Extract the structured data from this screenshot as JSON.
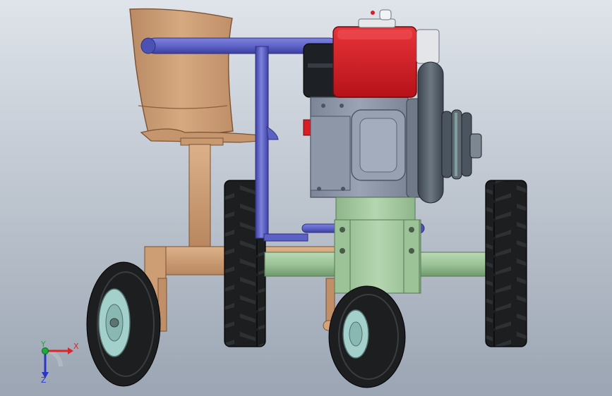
{
  "viewport": {
    "background_top": "#dfe4ea",
    "background_bottom": "#9ba5b3"
  },
  "colors": {
    "engine_red": "#d81d25",
    "engine_block": "#8d97a8",
    "frame_green": "#a6c9a2",
    "seat_brown": "#cfa078",
    "pipe_blue": "#5c61c4",
    "tire_black": "#1c1e20",
    "hub_teal": "#a4d0cc",
    "pulley_dark": "#4b5560"
  },
  "triad": {
    "x_label": "X",
    "y_label": "Y",
    "z_label": "Z",
    "x_color": "#d8262a",
    "y_color": "#1faa3a",
    "z_color": "#2a36c8"
  }
}
